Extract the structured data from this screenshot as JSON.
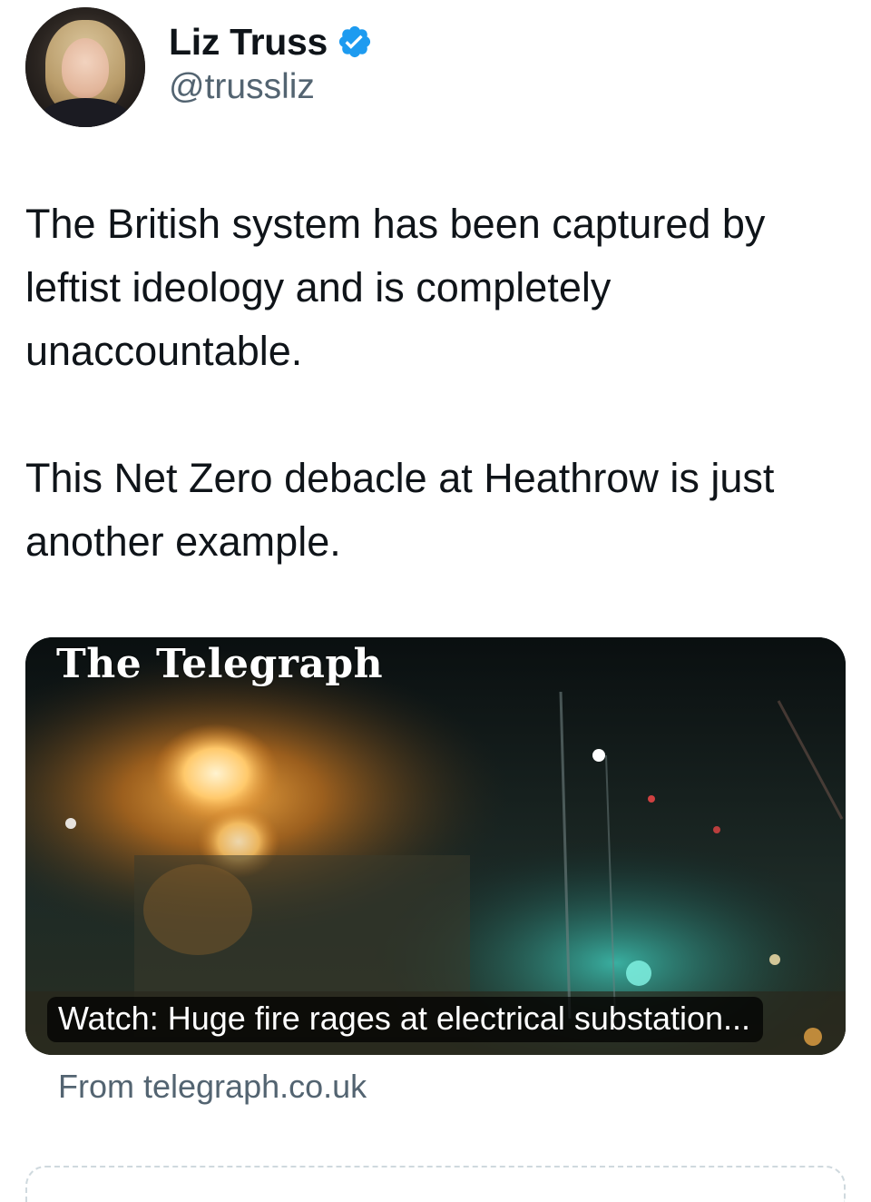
{
  "author": {
    "display_name": "Liz Truss",
    "handle": "@trussliz",
    "verified": true,
    "verified_color": "#1d9bf0"
  },
  "tweet": {
    "text": "The British system has been captured by leftist ideology and is completely unaccountable.\n\nThis Net Zero debacle at Heathrow is just another example."
  },
  "link_card": {
    "brand": "The Telegraph",
    "title": "Watch: Huge fire rages at electrical substation...",
    "domain": "From telegraph.co.uk"
  },
  "colors": {
    "text_primary": "#0f1419",
    "text_secondary": "#536471",
    "accent": "#1d9bf0"
  }
}
